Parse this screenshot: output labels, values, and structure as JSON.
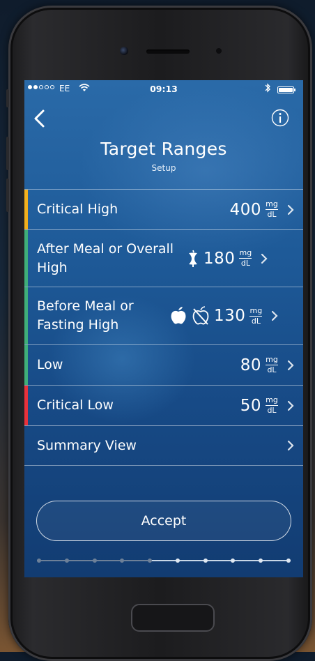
{
  "status_bar": {
    "carrier": "EE",
    "time": "09:13",
    "signal_bars_filled": 2,
    "signal_bars_total": 5
  },
  "header": {
    "title": "Target Ranges",
    "subtitle": "Setup"
  },
  "unit": {
    "numerator": "mg",
    "denominator": "dL"
  },
  "rows": [
    {
      "label": "Critical High",
      "value": "400",
      "accent": "#f2b01e",
      "icons": []
    },
    {
      "label": "After Meal or Overall High",
      "value": "180",
      "accent": "#3fae7a",
      "icons": [
        "apple-core-icon"
      ]
    },
    {
      "label": "Before Meal or Fasting High",
      "value": "130",
      "accent": "#3fae7a",
      "icons": [
        "apple-icon",
        "no-apple-icon"
      ]
    },
    {
      "label": "Low",
      "value": "80",
      "accent": "#3fae7a",
      "icons": []
    },
    {
      "label": "Critical Low",
      "value": "50",
      "accent": "#e8323c",
      "icons": []
    },
    {
      "label": "Summary View",
      "value": "",
      "accent": "",
      "icons": []
    }
  ],
  "accept_button": {
    "label": "Accept"
  },
  "progress": {
    "total_steps": 10,
    "current_step": 5
  },
  "colors": {
    "critical_high": "#f2b01e",
    "in_range": "#3fae7a",
    "critical_low": "#e8323c"
  }
}
